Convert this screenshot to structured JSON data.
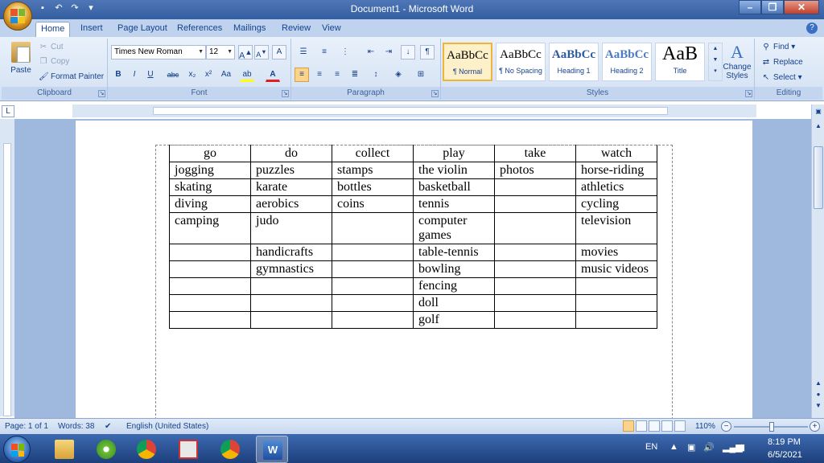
{
  "window": {
    "title": "Document1 - Microsoft Word",
    "controls": {
      "minimize": "–",
      "maximize": "❐",
      "close": "✕"
    }
  },
  "ribbon_tabs": [
    "Home",
    "Insert",
    "Page Layout",
    "References",
    "Mailings",
    "Review",
    "View"
  ],
  "clipboard": {
    "paste": "Paste",
    "cut": "Cut",
    "copy": "Copy",
    "format_painter": "Format Painter",
    "label": "Clipboard"
  },
  "font": {
    "name": "Times New Roman",
    "size": "12",
    "label": "Font",
    "bold": "B",
    "italic": "I",
    "underline": "U",
    "strike": "abc",
    "subscript": "x₂",
    "superscript": "x²",
    "change_case": "Aa",
    "grow": "A",
    "shrink": "A",
    "clear": "A",
    "highlight": "ab",
    "color": "A"
  },
  "paragraph": {
    "label": "Paragraph",
    "show_marks": "¶"
  },
  "styles": {
    "label": "Styles",
    "items": [
      {
        "preview": "AaBbCc",
        "name": "¶ Normal"
      },
      {
        "preview": "AaBbCc",
        "name": "¶ No Spacing"
      },
      {
        "preview": "AaBbCc",
        "name": "Heading 1"
      },
      {
        "preview": "AaBbCc",
        "name": "Heading 2"
      },
      {
        "preview": "AaB",
        "name": "Title"
      }
    ],
    "change_styles_1": "Change",
    "change_styles_2": "Styles"
  },
  "editing": {
    "label": "Editing",
    "find": "Find",
    "replace": "Replace",
    "select": "Select"
  },
  "table": {
    "headers": [
      "go",
      "do",
      "collect",
      "play",
      "take",
      "watch"
    ],
    "rows": [
      [
        "jogging",
        "puzzles",
        "stamps",
        "the violin",
        "photos",
        "horse-riding"
      ],
      [
        "skating",
        "karate",
        "bottles",
        "basketball",
        "",
        "athletics"
      ],
      [
        "diving",
        "aerobics",
        "coins",
        "tennis",
        "",
        "cycling"
      ],
      [
        "camping",
        "judo",
        "",
        "computer games",
        "",
        "television"
      ],
      [
        "",
        "handicrafts",
        "",
        "table-tennis",
        "",
        "movies"
      ],
      [
        "",
        "gymnastics",
        "",
        "bowling",
        "",
        "music videos"
      ],
      [
        "",
        "",
        "",
        "fencing",
        "",
        ""
      ],
      [
        "",
        "",
        "",
        "doll",
        "",
        ""
      ],
      [
        "",
        "",
        "",
        "golf",
        "",
        ""
      ]
    ]
  },
  "status": {
    "page": "Page: 1 of 1",
    "words": "Words: 38",
    "language": "English (United States)",
    "zoom": "110%"
  },
  "tray": {
    "lang": "EN",
    "time": "8:19 PM",
    "date": "6/5/2021"
  },
  "colors": {
    "accent": "#4f77b8",
    "font_color": "#e02020",
    "highlight": "#ffff00"
  }
}
